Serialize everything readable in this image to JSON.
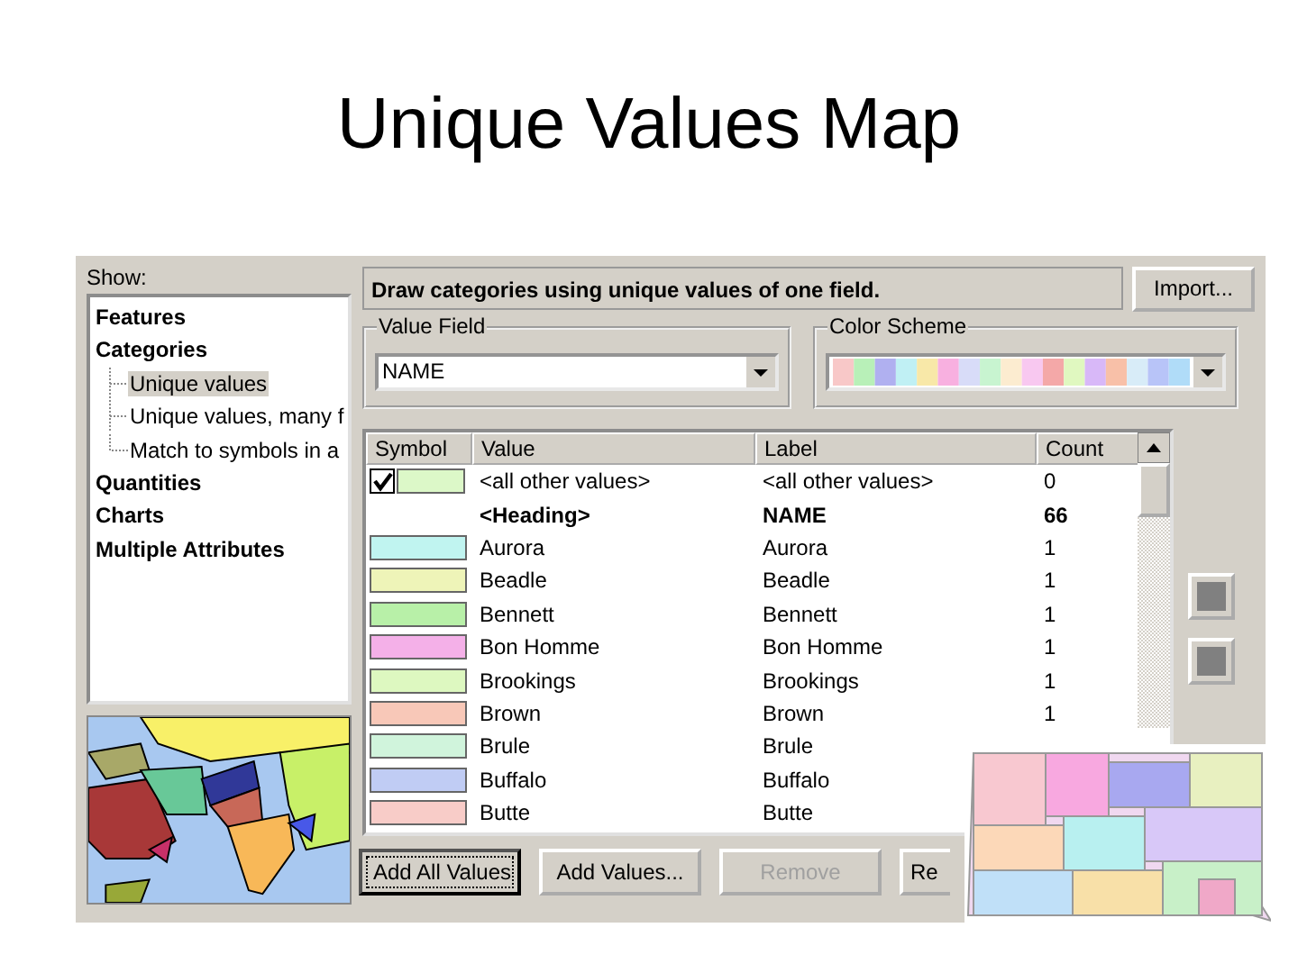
{
  "slide_title": "Unique Values Map",
  "show_label": "Show:",
  "tree": [
    {
      "label": "Features",
      "selected": false
    },
    {
      "label": "Categories",
      "selected": false,
      "children": [
        {
          "label": "Unique values",
          "selected": true
        },
        {
          "label": "Unique values, many f",
          "selected": false
        },
        {
          "label": "Match to symbols in a",
          "selected": false
        }
      ]
    },
    {
      "label": "Quantities",
      "selected": false
    },
    {
      "label": "Charts",
      "selected": false
    },
    {
      "label": "Multiple Attributes",
      "selected": false
    }
  ],
  "description": "Draw categories using unique values of one field.",
  "import_button": "Import...",
  "value_field": {
    "legend": "Value Field",
    "value": "NAME"
  },
  "color_scheme": {
    "legend": "Color Scheme"
  },
  "table": {
    "columns": [
      "Symbol",
      "Value",
      "Label",
      "Count"
    ],
    "rows": [
      {
        "kind": "other",
        "checked": true,
        "color": "#dcf8c8",
        "value": "<all other values>",
        "label": "<all other values>",
        "count": "0"
      },
      {
        "kind": "heading",
        "value": "<Heading>",
        "label": "NAME",
        "count": "66"
      },
      {
        "kind": "value",
        "color": "#c0f4f0",
        "value": "Aurora",
        "label": "Aurora",
        "count": "1"
      },
      {
        "kind": "value",
        "color": "#eef4b8",
        "value": "Beadle",
        "label": "Beadle",
        "count": "1"
      },
      {
        "kind": "value",
        "color": "#b8f0a8",
        "value": "Bennett",
        "label": "Bennett",
        "count": "1"
      },
      {
        "kind": "value",
        "color": "#f4b0e8",
        "value": "Bon Homme",
        "label": "Bon Homme",
        "count": "1"
      },
      {
        "kind": "value",
        "color": "#ddf8c0",
        "value": "Brookings",
        "label": "Brookings",
        "count": "1"
      },
      {
        "kind": "value",
        "color": "#f8c8b8",
        "value": "Brown",
        "label": "Brown",
        "count": "1"
      },
      {
        "kind": "value",
        "color": "#d0f4dc",
        "value": "Brule",
        "label": "Brule"
      },
      {
        "kind": "value",
        "color": "#c0ccf4",
        "value": "Buffalo",
        "label": "Buffalo"
      },
      {
        "kind": "value",
        "color": "#f8ccc8",
        "value": "Butte",
        "label": "Butte"
      }
    ]
  },
  "buttons": [
    {
      "label": "Add All Values",
      "focused": true,
      "disabled": false
    },
    {
      "label": "Add Values...",
      "focused": false,
      "disabled": false
    },
    {
      "label": "Remove",
      "focused": false,
      "disabled": true
    },
    {
      "label": "Re",
      "focused": false,
      "disabled": false
    }
  ]
}
